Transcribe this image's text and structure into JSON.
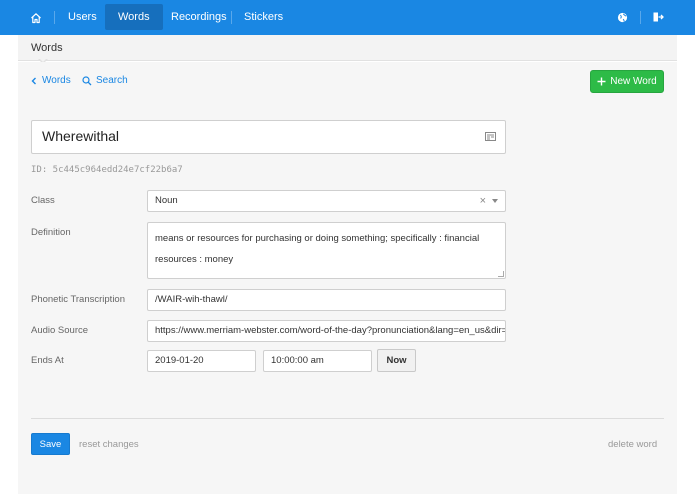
{
  "nav": {
    "home_icon": "home-icon",
    "items": [
      {
        "label": "Users",
        "active": false
      },
      {
        "label": "Words",
        "active": true
      },
      {
        "label": "Recordings",
        "active": false
      },
      {
        "label": "Stickers",
        "active": false
      }
    ],
    "right_icons": [
      "globe-icon",
      "logout-icon"
    ],
    "color": "#1a87e3",
    "active_color": "#166fbd"
  },
  "breadcrumb": {
    "title": "Words"
  },
  "toolbar": {
    "back_label": "Words",
    "search_label": "Search",
    "new_word_label": "New Word",
    "new_word_color": "#2dbb47"
  },
  "word": {
    "value": "Wherewithal",
    "id_text": "ID: 5c445c964edd24e7cf22b6a7"
  },
  "fields": {
    "class": {
      "label": "Class",
      "value": "Noun"
    },
    "definition": {
      "label": "Definition",
      "value": "means or resources for purchasing or doing something; specifically : financial resources : money"
    },
    "phonetic": {
      "label": "Phonetic Transcription",
      "value": "/WAIR-wih-thawl/"
    },
    "audio": {
      "label": "Audio Source",
      "value": "https://www.merriam-webster.com/word-of-the-day?pronunciation&lang=en_us&dir=w"
    },
    "ends_at": {
      "label": "Ends At",
      "date": "2019-01-20",
      "time": "10:00:00 am",
      "now_label": "Now"
    }
  },
  "actions": {
    "save_label": "Save",
    "reset_label": "reset changes",
    "delete_label": "delete word"
  }
}
